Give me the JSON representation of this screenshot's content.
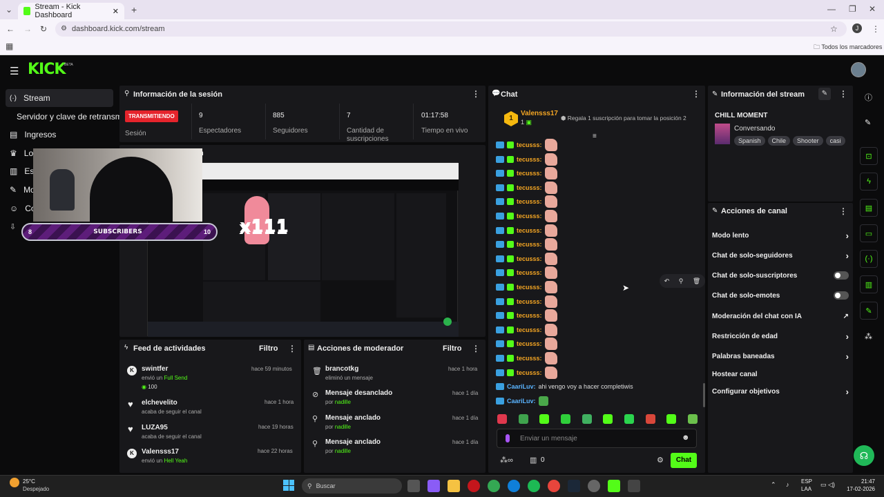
{
  "browser": {
    "tab_title": "Stream - Kick Dashboard",
    "url": "dashboard.kick.com/stream",
    "bookmarks_label": "Todos los marcadores",
    "profile_initial": "J"
  },
  "app": {
    "logo": "KICK",
    "beta": "BETA",
    "accent": "#53fc18"
  },
  "sidebar": {
    "items": [
      {
        "label": "Stream",
        "icon": "stream-icon"
      },
      {
        "label": "Servidor y clave de retransmisión",
        "icon": ""
      },
      {
        "label": "Ingresos",
        "icon": "money-icon"
      },
      {
        "label": "Lo",
        "icon": "trophy-icon"
      },
      {
        "label": "Es",
        "icon": "stats-icon"
      },
      {
        "label": "Mo",
        "icon": "wrench-icon"
      },
      {
        "label": "Co",
        "icon": "people-icon"
      }
    ]
  },
  "session": {
    "title": "Información de la sesión",
    "status": "TRANSMITIENDO",
    "status_label": "Sesión",
    "stats": [
      {
        "value": "9",
        "label": "Espectadores"
      },
      {
        "value": "885",
        "label": "Seguidores"
      },
      {
        "value": "7",
        "label": "Cantidad de suscripciones"
      },
      {
        "value": "01:17:58",
        "label": "Tiempo en vivo"
      }
    ]
  },
  "preview": {
    "title_fragment": "n",
    "overlay_left": "8",
    "overlay_center": "SUBSCRIBERS",
    "overlay_right": "10",
    "overlay_multiplier": "x111"
  },
  "feed": {
    "title": "Feed de actividades",
    "filter": "Filtro",
    "items": [
      {
        "user": "swintfer",
        "sub": "envió un",
        "highlight": "Full Send",
        "extra": "100",
        "time": "hace 59 minutos",
        "icon": "kick-coin-icon"
      },
      {
        "user": "elchevelito",
        "sub": "acaba de seguir el canal",
        "highlight": "",
        "extra": "",
        "time": "hace 1 hora",
        "icon": "heart-icon"
      },
      {
        "user": "LUZA95",
        "sub": "acaba de seguir el canal",
        "highlight": "",
        "extra": "",
        "time": "hace 19 horas",
        "icon": "heart-icon"
      },
      {
        "user": "Valensss17",
        "sub": "envió un",
        "highlight": "Hell Yeah",
        "extra": "",
        "time": "hace 22 horas",
        "icon": "kick-coin-icon"
      }
    ]
  },
  "modactions": {
    "title": "Acciones de moderador",
    "filter": "Filtro",
    "items": [
      {
        "title": "brancotkg",
        "sub": "eliminó un mensaje",
        "by": "",
        "time": "hace 1 hora",
        "icon": "trash-icon"
      },
      {
        "title": "Mensaje desanclado",
        "sub": "por",
        "by": "nadille",
        "time": "hace 1 día",
        "icon": "unpin-icon"
      },
      {
        "title": "Mensaje anclado",
        "sub": "por",
        "by": "nadille",
        "time": "hace 1 día",
        "icon": "pin-icon"
      },
      {
        "title": "Mensaje anclado",
        "sub": "por",
        "by": "nadille",
        "time": "hace 1 día",
        "icon": "pin-icon"
      }
    ]
  },
  "chat": {
    "title": "Chat",
    "top_gifter": "Valensss17",
    "top_gifter_count": "1",
    "gift_prompt": "Regala 1 suscripción para tomar la posición 2",
    "repeated_user": "tecusss:",
    "repeated_count": 17,
    "last_messages": [
      {
        "user": "CaariLuv:",
        "text": "ahi vengo voy a hacer completiwis"
      },
      {
        "user": "CaariLuv:",
        "text": ""
      }
    ],
    "input_placeholder": "Enviar un mensaje",
    "points": "0",
    "send_label": "Chat"
  },
  "streaminfo": {
    "title": "Información del stream",
    "stream_title": "CHILL MOMENT",
    "category": "Conversando",
    "tags": [
      "Spanish",
      "Chile",
      "Shooter",
      "casi"
    ]
  },
  "channelactions": {
    "title": "Acciones de canal",
    "items": [
      {
        "label": "Modo lento",
        "control": "chevron"
      },
      {
        "label": "Chat de solo-seguidores",
        "control": "chevron"
      },
      {
        "label": "Chat de solo-suscriptores",
        "control": "toggle"
      },
      {
        "label": "Chat de solo-emotes",
        "control": "toggle"
      },
      {
        "label": "Moderación del chat con IA",
        "control": "external"
      },
      {
        "label": "Restricción de edad",
        "control": "chevron"
      },
      {
        "label": "Palabras baneadas",
        "control": "chevron"
      },
      {
        "label": "Hostear canal",
        "control": "none"
      },
      {
        "label": "Configurar objetivos",
        "control": "chevron"
      }
    ]
  },
  "taskbar": {
    "weather_temp": "25°C",
    "weather_desc": "Despejado",
    "search_placeholder": "Buscar",
    "lang_top": "ESP",
    "lang_bottom": "LAA",
    "time": "21:47",
    "date": "17-02-2026"
  }
}
